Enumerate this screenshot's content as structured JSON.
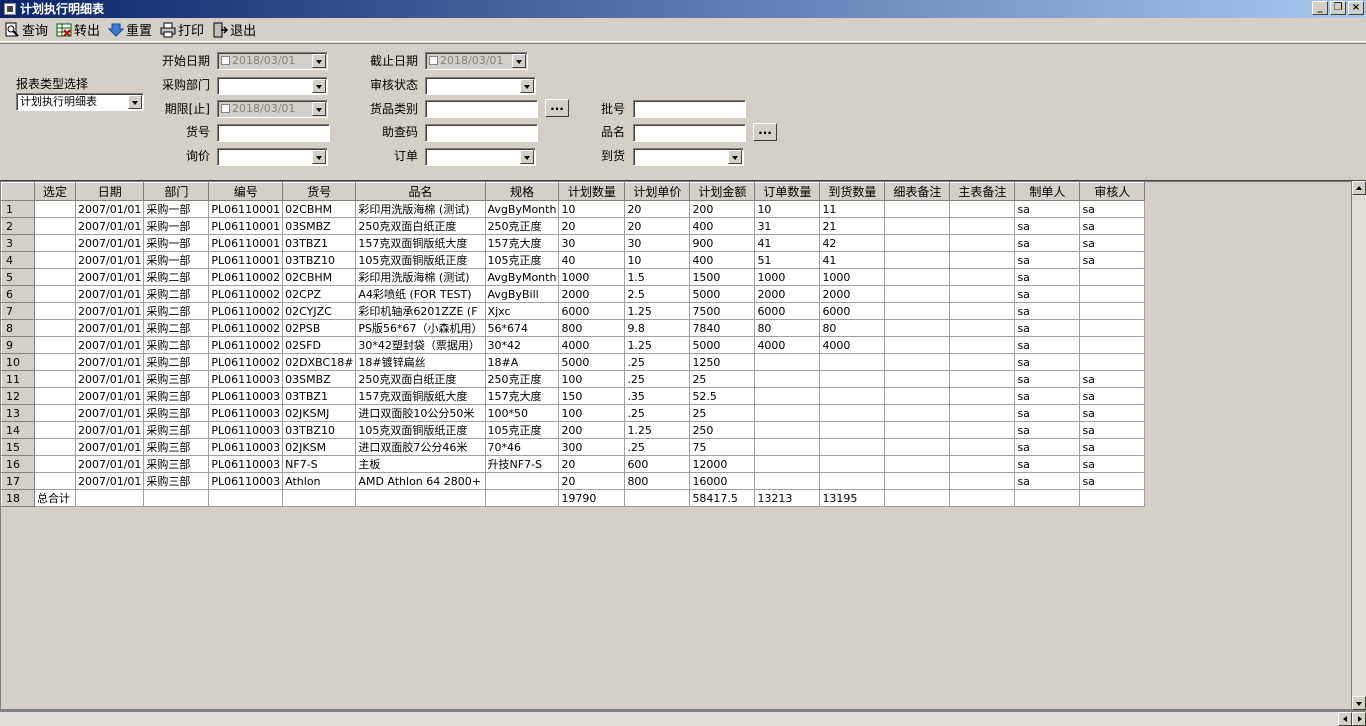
{
  "window": {
    "title": "计划执行明细表",
    "btn_min": "_",
    "btn_restore": "❐",
    "btn_close": "×"
  },
  "toolbar": {
    "query": "查询",
    "export": "转出",
    "reset": "重置",
    "print": "打印",
    "exit": "退出"
  },
  "form": {
    "report_type_label": "报表类型选择",
    "report_type_value": "计划执行明细表",
    "start_date_label": "开始日期",
    "start_date_value": "2018/03/01",
    "end_date_label": "截止日期",
    "end_date_value": "2018/03/01",
    "dept_label": "采购部门",
    "dept_value": "",
    "audit_label": "审核状态",
    "audit_value": "",
    "deadline_label": "期限[止]",
    "deadline_value": "2018/03/01",
    "category_label": "货品类别",
    "category_value": "",
    "category_btn": "...",
    "batch_label": "批号",
    "batch_value": "",
    "item_no_label": "货号",
    "item_no_value": "",
    "helper_label": "助查码",
    "helper_value": "",
    "item_name_label": "品名",
    "item_name_value": "",
    "item_name_btn": "...",
    "inquiry_label": "询价",
    "inquiry_value": "",
    "order_label": "订单",
    "order_value": "",
    "arrival_label": "到货",
    "arrival_value": ""
  },
  "grid": {
    "columns": [
      "",
      "选定",
      "日期",
      "部门",
      "编号",
      "货号",
      "品名",
      "规格",
      "计划数量",
      "计划单价",
      "计划金额",
      "订单数量",
      "到货数量",
      "细表备注",
      "主表备注",
      "制单人",
      "审核人"
    ],
    "rows": [
      [
        "1",
        "",
        "2007/01/01",
        "采购一部",
        "PL06110001",
        "02CBHM",
        "彩印用洗版海棉 (测试)",
        "AvgByMonth",
        "10",
        "20",
        "200",
        "10",
        "11",
        "",
        "",
        "sa",
        "sa"
      ],
      [
        "2",
        "",
        "2007/01/01",
        "采购一部",
        "PL06110001",
        "03SMBZ",
        "250克双面白纸正度",
        "250克正度",
        "20",
        "20",
        "400",
        "31",
        "21",
        "",
        "",
        "sa",
        "sa"
      ],
      [
        "3",
        "",
        "2007/01/01",
        "采购一部",
        "PL06110001",
        "03TBZ1",
        "157克双面铜版纸大度",
        "157克大度",
        "30",
        "30",
        "900",
        "41",
        "42",
        "",
        "",
        "sa",
        "sa"
      ],
      [
        "4",
        "",
        "2007/01/01",
        "采购一部",
        "PL06110001",
        "03TBZ10",
        "105克双面铜版纸正度",
        "105克正度",
        "40",
        "10",
        "400",
        "51",
        "41",
        "",
        "",
        "sa",
        "sa"
      ],
      [
        "5",
        "",
        "2007/01/01",
        "采购二部",
        "PL06110002",
        "02CBHM",
        "彩印用洗版海棉 (测试)",
        "AvgByMonth",
        "1000",
        "1.5",
        "1500",
        "1000",
        "1000",
        "",
        "",
        "sa",
        ""
      ],
      [
        "6",
        "",
        "2007/01/01",
        "采购二部",
        "PL06110002",
        "02CPZ",
        "A4彩喷纸 (FOR TEST)",
        "AvgByBill",
        "2000",
        "2.5",
        "5000",
        "2000",
        "2000",
        "",
        "",
        "sa",
        ""
      ],
      [
        "7",
        "",
        "2007/01/01",
        "采购二部",
        "PL06110002",
        "02CYJZC",
        "彩印机轴承6201ZZE (F",
        "Xjxc",
        "6000",
        "1.25",
        "7500",
        "6000",
        "6000",
        "",
        "",
        "sa",
        ""
      ],
      [
        "8",
        "",
        "2007/01/01",
        "采购二部",
        "PL06110002",
        "02PSB",
        "PS版56*67（小森机用）",
        "56*674",
        "800",
        "9.8",
        "7840",
        "80",
        "80",
        "",
        "",
        "sa",
        ""
      ],
      [
        "9",
        "",
        "2007/01/01",
        "采购二部",
        "PL06110002",
        "02SFD",
        "30*42塑封袋（票据用）",
        "30*42",
        "4000",
        "1.25",
        "5000",
        "4000",
        "4000",
        "",
        "",
        "sa",
        ""
      ],
      [
        "10",
        "",
        "2007/01/01",
        "采购二部",
        "PL06110002",
        "02DXBC18#",
        "18#镀锌扁丝",
        "18#A",
        "5000",
        ".25",
        "1250",
        "",
        "",
        "",
        "",
        "sa",
        ""
      ],
      [
        "11",
        "",
        "2007/01/01",
        "采购三部",
        "PL06110003",
        "03SMBZ",
        "250克双面白纸正度",
        "250克正度",
        "100",
        ".25",
        "25",
        "",
        "",
        "",
        "",
        "sa",
        "sa"
      ],
      [
        "12",
        "",
        "2007/01/01",
        "采购三部",
        "PL06110003",
        "03TBZ1",
        "157克双面铜版纸大度",
        "157克大度",
        "150",
        ".35",
        "52.5",
        "",
        "",
        "",
        "",
        "sa",
        "sa"
      ],
      [
        "13",
        "",
        "2007/01/01",
        "采购三部",
        "PL06110003",
        "02JKSMJ",
        "进口双面胶10公分50米",
        "100*50",
        "100",
        ".25",
        "25",
        "",
        "",
        "",
        "",
        "sa",
        "sa"
      ],
      [
        "14",
        "",
        "2007/01/01",
        "采购三部",
        "PL06110003",
        "03TBZ10",
        "105克双面铜版纸正度",
        "105克正度",
        "200",
        "1.25",
        "250",
        "",
        "",
        "",
        "",
        "sa",
        "sa"
      ],
      [
        "15",
        "",
        "2007/01/01",
        "采购三部",
        "PL06110003",
        "02JKSM",
        "进口双面胶7公分46米",
        "70*46",
        "300",
        ".25",
        "75",
        "",
        "",
        "",
        "",
        "sa",
        "sa"
      ],
      [
        "16",
        "",
        "2007/01/01",
        "采购三部",
        "PL06110003",
        "NF7-S",
        "主板",
        "升技NF7-S",
        "20",
        "600",
        "12000",
        "",
        "",
        "",
        "",
        "sa",
        "sa"
      ],
      [
        "17",
        "",
        "2007/01/01",
        "采购三部",
        "PL06110003",
        "Athlon",
        "AMD Athlon 64 2800+",
        "",
        "20",
        "800",
        "16000",
        "",
        "",
        "",
        "",
        "sa",
        "sa"
      ],
      [
        "18",
        "总合计",
        "",
        "",
        "",
        "",
        "",
        "",
        "19790",
        "",
        "58417.5",
        "13213",
        "13195",
        "",
        "",
        "",
        ""
      ]
    ]
  }
}
